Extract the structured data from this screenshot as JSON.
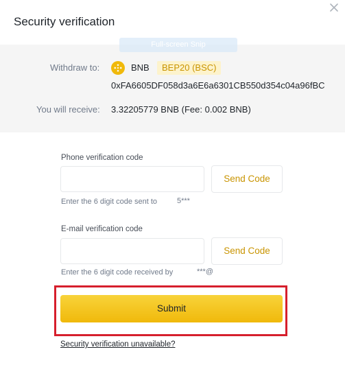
{
  "dialog": {
    "title": "Security verification",
    "close_icon": "close-icon"
  },
  "overlay": {
    "text": "Full-screen Snip"
  },
  "withdraw": {
    "label": "Withdraw to:",
    "coin": "BNB",
    "coin_icon": "bnb-icon",
    "network": "BEP20 (BSC)",
    "address": "0xFA6605DF058d3a6E6a6301CB550d354c04a96fBC"
  },
  "receive": {
    "label": "You will receive:",
    "value": "3.32205779 BNB (Fee: 0.002 BNB)"
  },
  "phone": {
    "label": "Phone verification code",
    "value": "",
    "send_label": "Send Code",
    "hint_prefix": "Enter the 6 digit code sent to",
    "hint_target": "5***"
  },
  "email": {
    "label": "E-mail verification code",
    "value": "",
    "send_label": "Send Code",
    "hint_prefix": "Enter the 6 digit code received by",
    "hint_target": "***@"
  },
  "submit_label": "Submit",
  "unavailable_link": "Security verification unavailable?",
  "colors": {
    "accent": "#F0B90B",
    "accent_text": "#C99400",
    "highlight_border": "#D61F2C"
  }
}
